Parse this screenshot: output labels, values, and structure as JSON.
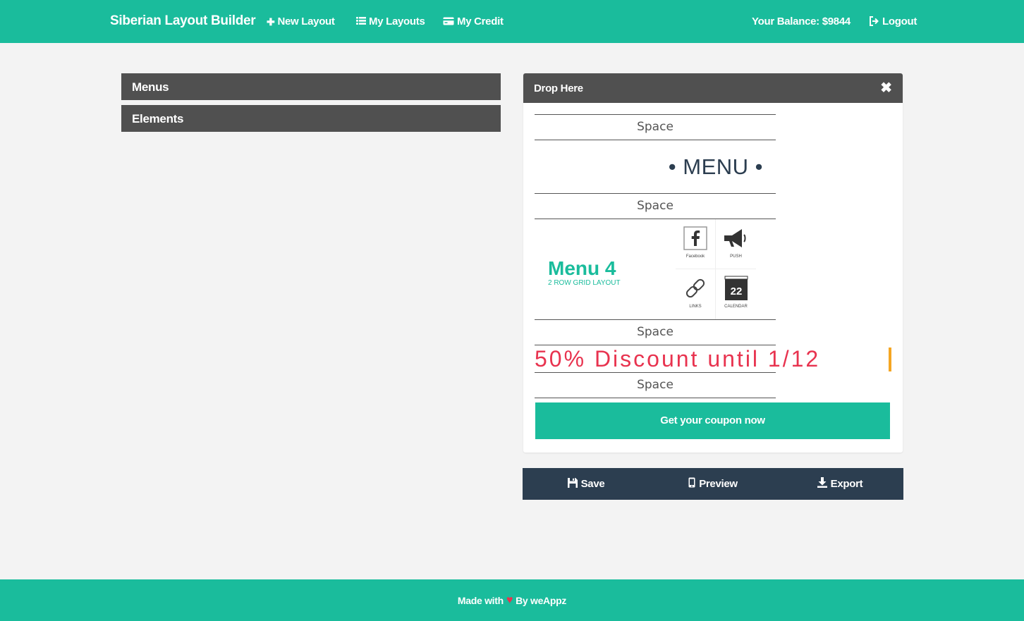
{
  "navbar": {
    "brand": "Siberian Layout Builder",
    "new_layout": "New Layout",
    "my_layouts": "My Layouts",
    "my_credit": "My Credit",
    "balance": "Your Balance: $9844",
    "logout": "Logout"
  },
  "sidebar": {
    "menus": "Menus",
    "elements": "Elements"
  },
  "drop_area": {
    "title": "Drop Here",
    "space_label": "Space",
    "menu_title": "• MENU •",
    "menu4": {
      "title": "Menu 4",
      "subtitle": "2 ROW GRID LAYOUT",
      "items": [
        {
          "icon": "facebook-icon",
          "label": "Facebook"
        },
        {
          "icon": "megaphone-icon",
          "label": "PUSH"
        },
        {
          "icon": "link-icon",
          "label": "LINKS"
        },
        {
          "icon": "calendar-icon",
          "label": "CALENDAR",
          "day": "22"
        }
      ]
    },
    "discount_text": "50% Discount until 1/12",
    "coupon_button": "Get your coupon now"
  },
  "actions": {
    "save": "Save",
    "preview": "Preview",
    "export": "Export"
  },
  "footer": {
    "made_with": "Made with",
    "by": "By weAppz"
  },
  "colors": {
    "primary": "#1abc9c",
    "panel": "#505050",
    "action_bar": "#2c3e50",
    "discount": "#e8334f",
    "accent_bar": "#f5a623"
  }
}
